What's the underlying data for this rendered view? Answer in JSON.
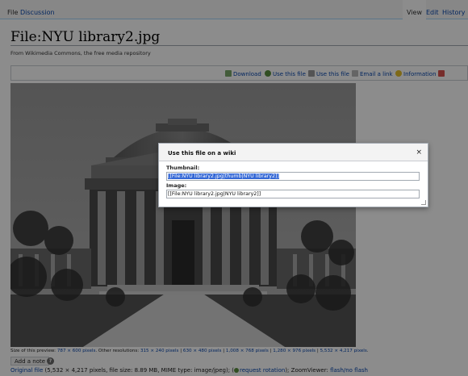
{
  "tabs": {
    "file": "File",
    "discussion": "Discussion",
    "view": "View",
    "edit": "Edit",
    "history": "History"
  },
  "page": {
    "title": "File:NYU library2.jpg",
    "subtitle": "From Wikimedia Commons, the free media repository"
  },
  "toolbar": {
    "download": "Download",
    "use_file_1": "Use this file",
    "use_file_2": "Use this file",
    "email": "Email a link",
    "information": "Information"
  },
  "preview": {
    "size_label": "Size of this preview: ",
    "size_value": "787 × 600 pixels",
    "other_label": ". Other resolutions: ",
    "res": [
      "315 × 240 pixels",
      "630 × 480 pixels",
      "1,008 × 768 pixels",
      "1,280 × 976 pixels",
      "5,532 × 4,217 pixels"
    ],
    "sep": " | ",
    "end": "."
  },
  "add_note": "Add a note",
  "help": "?",
  "footer": {
    "original": "Original file",
    "details": " (5,532 × 4,217 pixels, file size: 8.89 MB, MIME type: image/jpeg); (",
    "request": "request rotation",
    "zoom": "); ZoomViewer: ",
    "flash": "flash/no flash"
  },
  "dialog": {
    "title": "Use this file on a wiki",
    "close": "×",
    "thumb_label": "Thumbnail:",
    "thumb_value": "[[File:NYU library2.jpg|thumb|NYU library2]]",
    "image_label": "Image:",
    "image_value": "[[File:NYU library2.jpg|NYU library2]]"
  },
  "colors": {
    "link": "#0645ad",
    "selection": "#3367d6",
    "overlay": "#000000"
  }
}
